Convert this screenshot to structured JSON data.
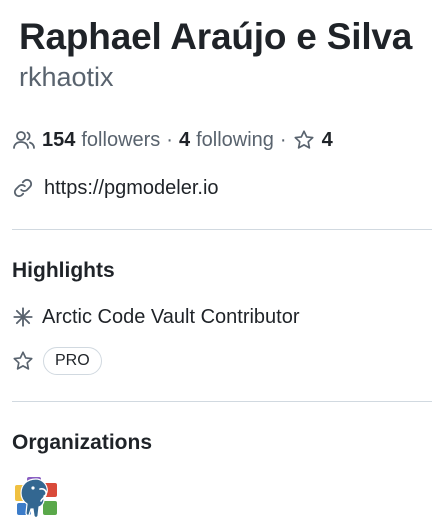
{
  "profile": {
    "name": "Raphael Araújo e Silva",
    "login": "rkhaotix",
    "followers_count": "154",
    "followers_label": "followers",
    "following_count": "4",
    "following_label": "following",
    "separator": "·",
    "stars_count": "4",
    "website": "https://pgmodeler.io"
  },
  "highlights": {
    "title": "Highlights",
    "items": [
      {
        "label": "Arctic Code Vault Contributor",
        "icon": "snowflake-icon"
      }
    ],
    "pro_badge": "PRO"
  },
  "organizations": {
    "title": "Organizations",
    "items": [
      {
        "icon": "pgmodeler-elephant-avatar"
      }
    ]
  },
  "colors": {
    "text": "#1f2328",
    "muted": "#59636e",
    "border": "#d1d9e0"
  }
}
